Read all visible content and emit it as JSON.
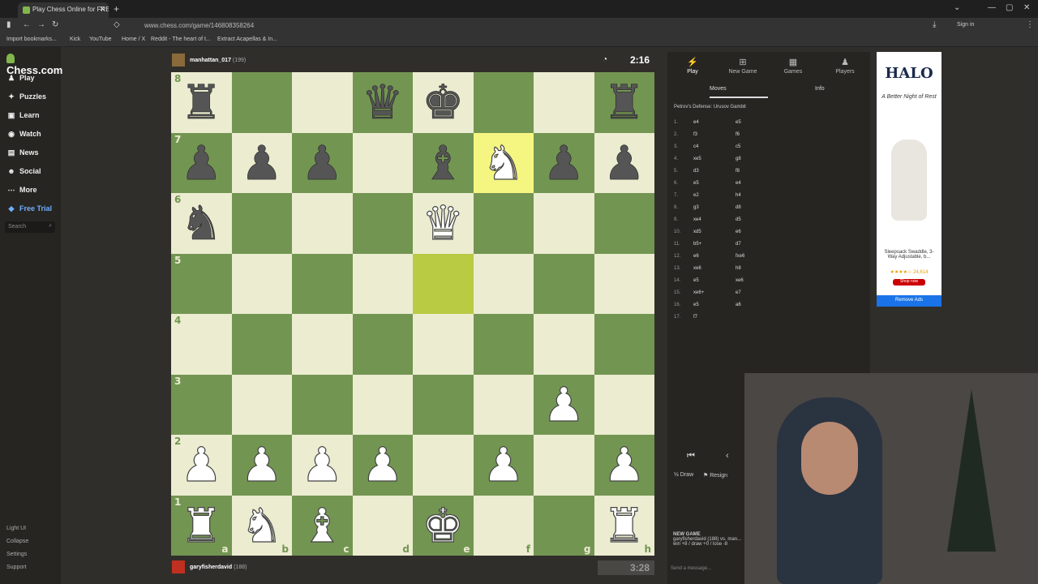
{
  "browser": {
    "tab_title": "Play Chess Online for FREE",
    "url": "www.chess.com/game/146808358264",
    "signin": "Sign in",
    "bookmarks": [
      "Import bookmarks...",
      "Kick",
      "YouTube",
      "Home / X",
      "Reddit - The heart of t...",
      "Extract Acapellas & In..."
    ]
  },
  "sidebar": {
    "logo": "Chess.com",
    "items": [
      {
        "label": "Play",
        "icon": "play-icon"
      },
      {
        "label": "Puzzles",
        "icon": "puzzle-icon"
      },
      {
        "label": "Learn",
        "icon": "learn-icon"
      },
      {
        "label": "Watch",
        "icon": "watch-icon"
      },
      {
        "label": "News",
        "icon": "news-icon"
      },
      {
        "label": "Social",
        "icon": "social-icon"
      },
      {
        "label": "More",
        "icon": "more-icon"
      },
      {
        "label": "Free Trial",
        "icon": "diamond-icon"
      }
    ],
    "search_placeholder": "Search",
    "footer": [
      "Light UI",
      "Collapse",
      "Settings",
      "Support"
    ]
  },
  "game": {
    "top_player": {
      "name": "manhattan_017",
      "rating": "(199)"
    },
    "top_clock": "2:16",
    "bottom_player": {
      "name": "garyfisherdavid",
      "rating": "(188)"
    },
    "bottom_clock": "3:28",
    "rank_labels": [
      "8",
      "7",
      "6",
      "5",
      "4",
      "3",
      "2",
      "1"
    ],
    "file_labels": [
      "a",
      "b",
      "c",
      "d",
      "e",
      "f",
      "g",
      "h"
    ],
    "board": [
      [
        "br",
        "",
        "",
        "bq",
        "bk",
        "",
        "",
        "br"
      ],
      [
        "bp",
        "bp",
        "bp",
        "",
        "bb",
        "wn",
        "bp",
        "bp"
      ],
      [
        "bn",
        "",
        "",
        "",
        "wq",
        "",
        "",
        ""
      ],
      [
        "",
        "",
        "",
        "",
        "",
        "",
        "",
        ""
      ],
      [
        "",
        "",
        "",
        "",
        "",
        "",
        "",
        ""
      ],
      [
        "",
        "",
        "",
        "",
        "",
        "",
        "wp",
        ""
      ],
      [
        "wp",
        "wp",
        "wp",
        "wp",
        "",
        "wp",
        "",
        "wp"
      ],
      [
        "wr",
        "wn",
        "wb",
        "",
        "wk",
        "",
        "",
        "wr"
      ]
    ],
    "highlights": [
      [
        1,
        5
      ],
      [
        3,
        4
      ]
    ]
  },
  "panel": {
    "tabs": [
      "Play",
      "New Game",
      "Games",
      "Players"
    ],
    "subtabs": [
      "Moves",
      "Info"
    ],
    "opening": "Petrov's Defense: Urusov Gambit",
    "moves": [
      {
        "n": "1.",
        "w": "e4",
        "b": "e5"
      },
      {
        "n": "2.",
        "w": "f3",
        "b": "f6"
      },
      {
        "n": "3.",
        "w": "c4",
        "b": "c5"
      },
      {
        "n": "4.",
        "w": "xe5",
        "b": "g8"
      },
      {
        "n": "5.",
        "w": "d3",
        "b": "f8"
      },
      {
        "n": "6.",
        "w": "e5",
        "b": "e4"
      },
      {
        "n": "7.",
        "w": "e2",
        "b": "h4"
      },
      {
        "n": "8.",
        "w": "g3",
        "b": "d8"
      },
      {
        "n": "9.",
        "w": "xe4",
        "b": "d5"
      },
      {
        "n": "10.",
        "w": "xd5",
        "b": "e6"
      },
      {
        "n": "11.",
        "w": "b5+",
        "b": "d7"
      },
      {
        "n": "12.",
        "w": "e6",
        "b": "fxe6"
      },
      {
        "n": "13.",
        "w": "xe6",
        "b": "h8"
      },
      {
        "n": "14.",
        "w": "e5",
        "b": "xe6"
      },
      {
        "n": "15.",
        "w": "xe6+",
        "b": "e7"
      },
      {
        "n": "16.",
        "w": "e5",
        "b": "a6"
      },
      {
        "n": "17.",
        "w": "f7",
        "b": ""
      }
    ],
    "draw": "Draw",
    "resign": "Resign",
    "new_game_title": "NEW GAME",
    "new_game_line1": "garyfisherdavid (188) vs. man...",
    "new_game_line2": "win +8 / draw +0 / lose -8",
    "chat_placeholder": "Send a message..."
  },
  "ad": {
    "brand": "HALO",
    "tagline": "A Better Night of Rest",
    "desc": "Sleepsack Swaddle, 3-Way Adjustable, b...",
    "rating": "★★★★☆ 24,614",
    "shop": "Shop now",
    "remove": "Remove Ads"
  }
}
